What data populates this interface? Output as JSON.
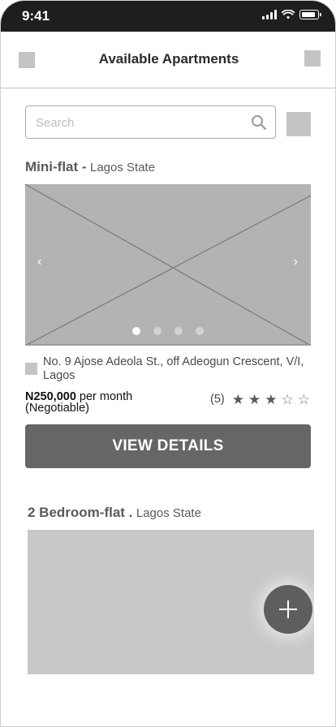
{
  "status_bar": {
    "time": "9:41"
  },
  "header": {
    "title": "Available Apartments"
  },
  "search": {
    "placeholder": "Search"
  },
  "listings": [
    {
      "type": "Mini-flat -",
      "state": "Lagos State",
      "address": "No. 9 Ajose Adeola St., off Adeogun Crescent, V/I, Lagos",
      "price": "N250,000",
      "price_suffix": "per month",
      "negotiable": "(Negotiable)",
      "review_count": "(5)",
      "rating": 3,
      "rating_max": 5,
      "carousel_prev": "‹",
      "carousel_next": "›",
      "carousel_slides": 4,
      "carousel_active": 1,
      "button_label": "VIEW DETAILS"
    },
    {
      "type": "2 Bedroom-flat .",
      "state": "Lagos State"
    }
  ],
  "colors": {
    "button": "#666666",
    "fab": "#5e5e5e",
    "placeholder_image": "#b3b3b3"
  }
}
